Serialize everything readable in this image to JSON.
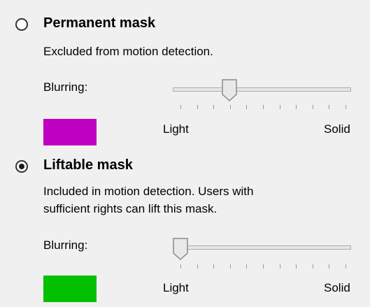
{
  "permanent": {
    "title": "Permanent mask",
    "selected": false,
    "description": "Excluded from motion detection.",
    "blurring_label": "Blurring:",
    "slider_value": 0.3,
    "min_label": "Light",
    "max_label": "Solid",
    "color": "#c000c0"
  },
  "liftable": {
    "title": "Liftable mask",
    "selected": true,
    "description_line1": "Included in motion detection. Users with",
    "description_line2": "sufficient rights can lift this mask.",
    "blurring_label": "Blurring:",
    "slider_value": 0.0,
    "min_label": "Light",
    "max_label": "Solid",
    "color": "#00c000"
  },
  "colors": {
    "slider_thumb": "#e8e8e8",
    "slider_border": "#8c8c8c"
  }
}
